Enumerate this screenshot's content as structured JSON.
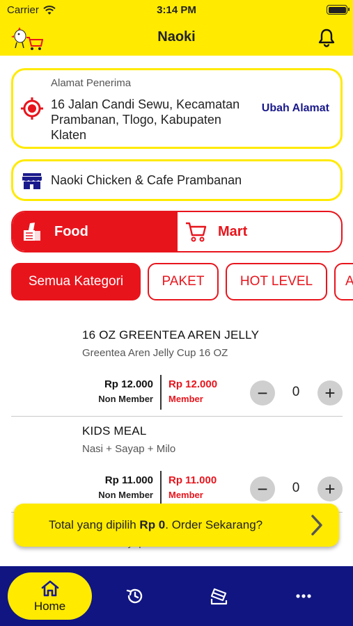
{
  "status_bar": {
    "carrier": "Carrier",
    "time": "3:14 PM"
  },
  "header": {
    "title": "Naoki"
  },
  "address": {
    "label": "Alamat Penerima",
    "value": "16 Jalan Candi Sewu, Kecamatan Prambanan, Tlogo, Kabupaten Klaten",
    "change_label": "Ubah Alamat"
  },
  "store": {
    "name": "Naoki Chicken & Cafe Prambanan"
  },
  "segments": {
    "food": "Food",
    "mart": "Mart"
  },
  "categories": [
    "Semua Kategori",
    "PAKET",
    "HOT LEVEL",
    "A"
  ],
  "products": [
    {
      "name": "16 OZ GREENTEA AREN JELLY",
      "desc": "Greentea Aren Jelly Cup 16 OZ",
      "price_nonmember": "Rp 12.000",
      "nonmember_label": "Non Member",
      "price_member": "Rp 12.000",
      "member_label": "Member",
      "qty": "0"
    },
    {
      "name": "KIDS MEAL",
      "desc": "Nasi + Sayap + Milo",
      "price_nonmember": "Rp 11.000",
      "nonmember_label": "Non Member",
      "price_member": "Rp 11.000",
      "member_label": "Member",
      "qty": "0"
    }
  ],
  "partial_item": {
    "desc": "Nasi + Sayap + Es Teh"
  },
  "order_bar": {
    "prefix": "Total yang dipilih ",
    "total": "Rp 0",
    "suffix": ". Order Sekarang?"
  },
  "tabbar": {
    "home_label": "Home"
  },
  "colors": {
    "brand_yellow": "#ffea00",
    "brand_red": "#e8141c",
    "nav_blue": "#101582"
  }
}
